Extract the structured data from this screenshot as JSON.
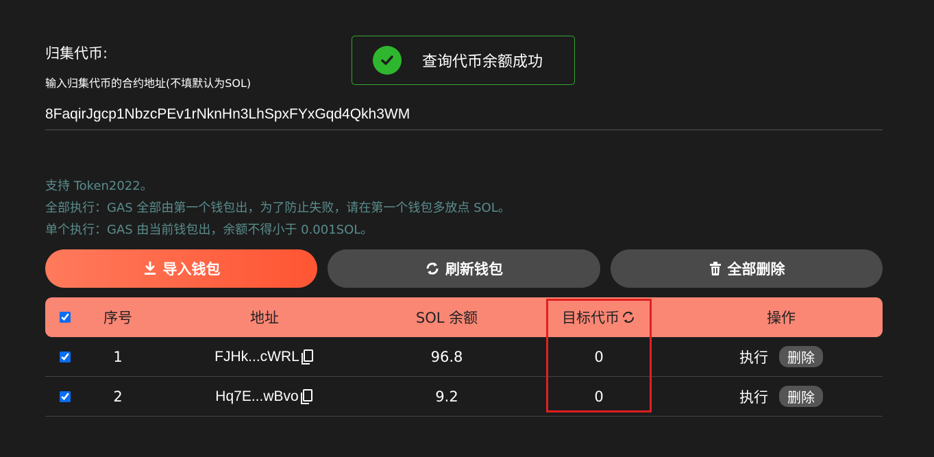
{
  "form": {
    "title": "归集代币:",
    "hint": "输入归集代币的合约地址(不填默认为SOL)",
    "token_address": "8FaqirJgcp1NbzcPEv1rNknHn3LhSpxFYxGqd4Qkh3WM"
  },
  "toast": {
    "message": "查询代币余额成功",
    "icon": "check-circle-icon",
    "color": "#2fb62f"
  },
  "notes": [
    "支持 Token2022。",
    "全部执行：GAS 全部由第一个钱包出，为了防止失败，请在第一个钱包多放点 SOL。",
    "单个执行：GAS 由当前钱包出，余额不得小于 0.001SOL。"
  ],
  "buttons": {
    "import": "导入钱包",
    "refresh": "刷新钱包",
    "delete_all": "全部删除"
  },
  "table": {
    "headers": {
      "index": "序号",
      "address": "地址",
      "sol_balance": "SOL 余额",
      "target_token": "目标代币",
      "actions": "操作"
    },
    "rows": [
      {
        "index": "1",
        "address": "FJHk...cWRL",
        "sol": "96.8",
        "target": "0",
        "exec": "执行",
        "delete": "删除",
        "checked": true
      },
      {
        "index": "2",
        "address": "Hq7E...wBvo",
        "sol": "9.2",
        "target": "0",
        "exec": "执行",
        "delete": "删除",
        "checked": true
      }
    ]
  },
  "colors": {
    "background": "#1c1c1c",
    "accent": "#ff5533",
    "header": "#fa8674",
    "note_text": "#5a8c8c",
    "highlight": "#e02020"
  }
}
